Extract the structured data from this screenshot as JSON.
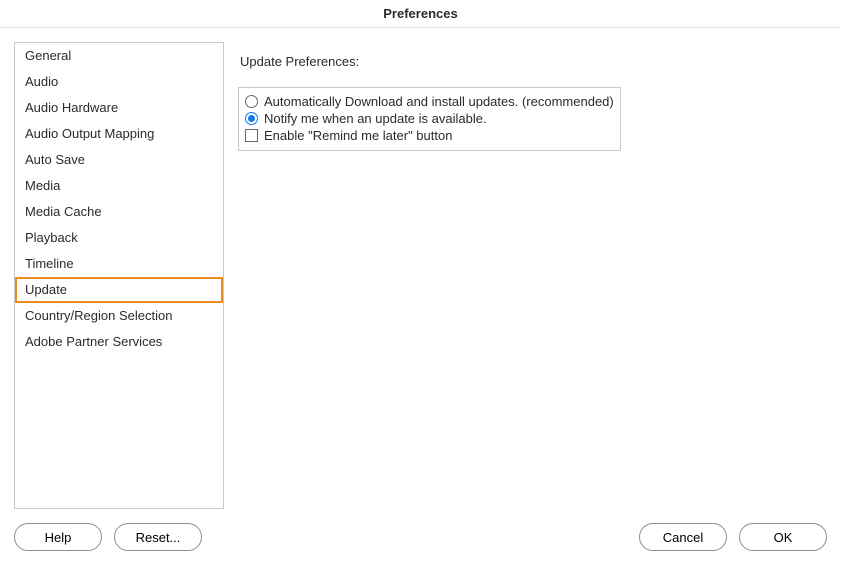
{
  "title": "Preferences",
  "sidebar": {
    "items": [
      {
        "label": "General",
        "selected": false
      },
      {
        "label": "Audio",
        "selected": false
      },
      {
        "label": "Audio Hardware",
        "selected": false
      },
      {
        "label": "Audio Output Mapping",
        "selected": false
      },
      {
        "label": "Auto Save",
        "selected": false
      },
      {
        "label": "Media",
        "selected": false
      },
      {
        "label": "Media Cache",
        "selected": false
      },
      {
        "label": "Playback",
        "selected": false
      },
      {
        "label": "Timeline",
        "selected": false
      },
      {
        "label": "Update",
        "selected": true
      },
      {
        "label": "Country/Region Selection",
        "selected": false
      },
      {
        "label": "Adobe Partner Services",
        "selected": false
      }
    ]
  },
  "main": {
    "section_title": "Update Preferences:",
    "options": [
      {
        "type": "radio",
        "label": "Automatically Download and install updates. (recommended)",
        "selected": false
      },
      {
        "type": "radio",
        "label": "Notify me when an update is available.",
        "selected": true
      },
      {
        "type": "checkbox",
        "label": "Enable \"Remind me later\" button",
        "checked": false
      }
    ]
  },
  "buttons": {
    "help": "Help",
    "reset": "Reset...",
    "cancel": "Cancel",
    "ok": "OK"
  }
}
